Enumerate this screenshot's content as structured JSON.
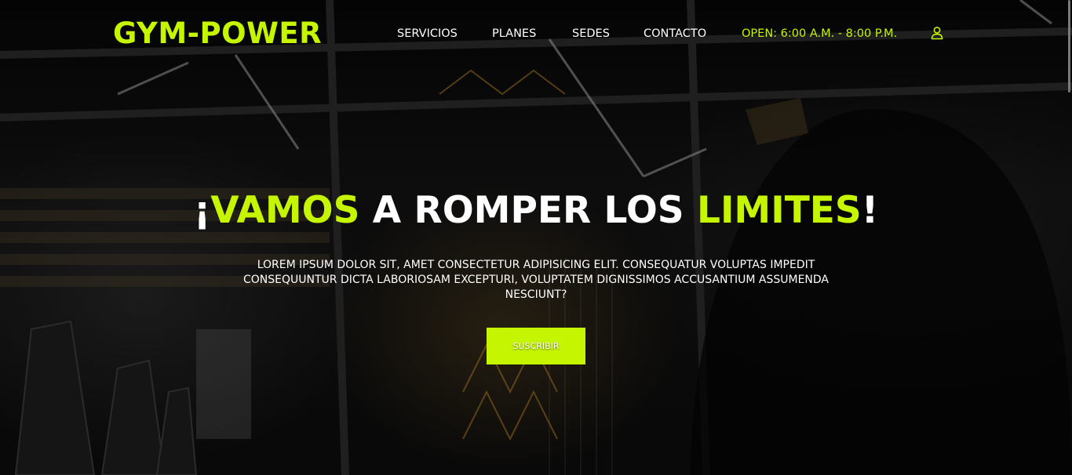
{
  "header": {
    "logo": "GYM-POWER",
    "nav": [
      {
        "label": "SERVICIOS"
      },
      {
        "label": "PLANES"
      },
      {
        "label": "SEDES"
      },
      {
        "label": "CONTACTO"
      }
    ],
    "hours": "OPEN: 6:00 A.M. - 8:00 P.M.",
    "user_icon": "user-icon"
  },
  "hero": {
    "headline": {
      "prefix": "¡",
      "word1": "VAMOS",
      "middle": " A ROMPER LOS ",
      "word2": "LIMITES",
      "suffix": "!"
    },
    "subtext": "LOREM IPSUM DOLOR SIT, AMET CONSECTETUR ADIPISICING ELIT. CONSEQUATUR VOLUPTAS IMPEDIT CONSEQUUNTUR DICTA LABORIOSAM EXCEPTURI, VOLUPTATEM DIGNISSIMOS ACCUSANTIUM ASSUMENDA NESCIUNT?",
    "cta_label": "SUSCRIBIR"
  },
  "colors": {
    "accent": "#c6f500",
    "text": "#ffffff",
    "background": "#0a0a0a"
  }
}
